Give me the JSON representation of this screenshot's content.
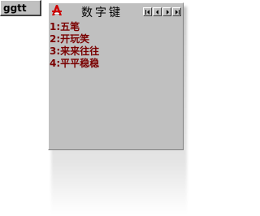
{
  "composition": {
    "input": "ggtt"
  },
  "candidate_window": {
    "logo_letter": "A",
    "title": "数字键",
    "nav": [
      "first-page",
      "previous-page",
      "next-page",
      "last-page"
    ],
    "candidates": [
      {
        "key": "1:",
        "text": "五笔"
      },
      {
        "key": "2:",
        "text": "开玩笑"
      },
      {
        "key": "3:",
        "text": "来来往往"
      },
      {
        "key": "4:",
        "text": "平平稳稳"
      }
    ],
    "colors": {
      "candidate_text": "#7a0000",
      "logo_red": "#cc0000",
      "panel": "#c0c0c0"
    }
  }
}
